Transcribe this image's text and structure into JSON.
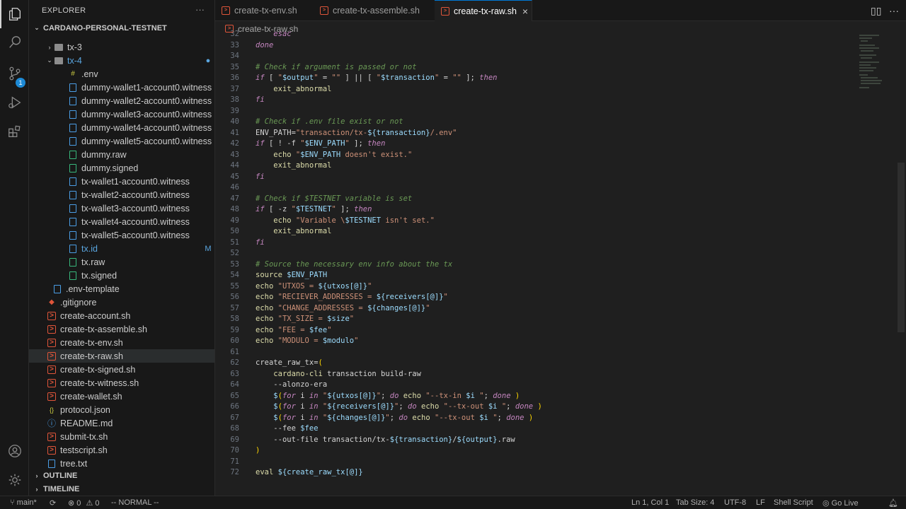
{
  "sidebar": {
    "title": "EXPLORER",
    "project": "CARDANO-PERSONAL-TESTNET",
    "outline": "OUTLINE",
    "timeline": "TIMELINE",
    "folders": {
      "tx3": "tx-3",
      "tx4": "tx-4"
    },
    "files": [
      {
        "name": ".env",
        "icon": "env-icon"
      },
      {
        "name": "dummy-wallet1-account0.witness",
        "icon": "file-icon"
      },
      {
        "name": "dummy-wallet2-account0.witness",
        "icon": "file-icon"
      },
      {
        "name": "dummy-wallet3-account0.witness",
        "icon": "file-icon"
      },
      {
        "name": "dummy-wallet4-account0.witness",
        "icon": "file-icon"
      },
      {
        "name": "dummy-wallet5-account0.witness",
        "icon": "file-icon"
      },
      {
        "name": "dummy.raw",
        "icon": "file-icon"
      },
      {
        "name": "dummy.signed",
        "icon": "file-icon"
      },
      {
        "name": "tx-wallet1-account0.witness",
        "icon": "file-icon"
      },
      {
        "name": "tx-wallet2-account0.witness",
        "icon": "file-icon"
      },
      {
        "name": "tx-wallet3-account0.witness",
        "icon": "file-icon"
      },
      {
        "name": "tx-wallet4-account0.witness",
        "icon": "file-icon"
      },
      {
        "name": "tx-wallet5-account0.witness",
        "icon": "file-icon"
      },
      {
        "name": "tx.id",
        "icon": "file-icon",
        "status": "M"
      },
      {
        "name": "tx.raw",
        "icon": "file-icon"
      },
      {
        "name": "tx.signed",
        "icon": "file-icon"
      },
      {
        "name": ".env-template",
        "icon": "file-icon"
      },
      {
        "name": ".gitignore",
        "icon": "git-icon"
      },
      {
        "name": "create-account.sh",
        "icon": "shell-icon"
      },
      {
        "name": "create-tx-assemble.sh",
        "icon": "shell-icon"
      },
      {
        "name": "create-tx-env.sh",
        "icon": "shell-icon"
      },
      {
        "name": "create-tx-raw.sh",
        "icon": "shell-icon"
      },
      {
        "name": "create-tx-signed.sh",
        "icon": "shell-icon"
      },
      {
        "name": "create-tx-witness.sh",
        "icon": "shell-icon"
      },
      {
        "name": "create-wallet.sh",
        "icon": "shell-icon"
      },
      {
        "name": "protocol.json",
        "icon": "json-icon"
      },
      {
        "name": "README.md",
        "icon": "info-icon"
      },
      {
        "name": "submit-tx.sh",
        "icon": "shell-icon"
      },
      {
        "name": "testscript.sh",
        "icon": "shell-icon"
      },
      {
        "name": "tree.txt",
        "icon": "file-icon"
      }
    ]
  },
  "tabs": [
    {
      "label": "create-tx-env.sh"
    },
    {
      "label": "create-tx-assemble.sh"
    },
    {
      "label": "create-tx-raw.sh"
    }
  ],
  "breadcrumb": "create-tx-raw.sh",
  "code_lines": [
    {
      "n": "32",
      "text": "    esac"
    },
    {
      "n": "33",
      "text": "done"
    },
    {
      "n": "34",
      "text": ""
    },
    {
      "n": "35",
      "text": "# Check if argument is passed or not"
    },
    {
      "n": "36",
      "text": "if [ \"$output\" = \"\" ] || [ \"$transaction\" = \"\" ]; then"
    },
    {
      "n": "37",
      "text": "    exit_abnormal"
    },
    {
      "n": "38",
      "text": "fi"
    },
    {
      "n": "39",
      "text": ""
    },
    {
      "n": "40",
      "text": "# Check if .env file exist or not"
    },
    {
      "n": "41",
      "text": "ENV_PATH=\"transaction/tx-${transaction}/.env\""
    },
    {
      "n": "42",
      "text": "if [ ! -f \"$ENV_PATH\" ]; then"
    },
    {
      "n": "43",
      "text": "    echo \"$ENV_PATH doesn't exist.\""
    },
    {
      "n": "44",
      "text": "    exit_abnormal"
    },
    {
      "n": "45",
      "text": "fi"
    },
    {
      "n": "46",
      "text": ""
    },
    {
      "n": "47",
      "text": "# Check if $TESTNET variable is set"
    },
    {
      "n": "48",
      "text": "if [ -z \"$TESTNET\" ]; then"
    },
    {
      "n": "49",
      "text": "    echo \"Variable \\$TESTNET isn't set.\""
    },
    {
      "n": "50",
      "text": "    exit_abnormal"
    },
    {
      "n": "51",
      "text": "fi"
    },
    {
      "n": "52",
      "text": ""
    },
    {
      "n": "53",
      "text": "# Source the necessary env info about the tx"
    },
    {
      "n": "54",
      "text": "source $ENV_PATH"
    },
    {
      "n": "55",
      "text": "echo \"UTXOS = ${utxos[@]}\""
    },
    {
      "n": "56",
      "text": "echo \"RECIEVER_ADDRESSES = ${receivers[@]}\""
    },
    {
      "n": "57",
      "text": "echo \"CHANGE_ADDRESSES = ${changes[@]}\""
    },
    {
      "n": "58",
      "text": "echo \"TX_SIZE = $size\""
    },
    {
      "n": "59",
      "text": "echo \"FEE = $fee\""
    },
    {
      "n": "60",
      "text": "echo \"MODULO = $modulo\""
    },
    {
      "n": "61",
      "text": ""
    },
    {
      "n": "62",
      "text": "create_raw_tx=("
    },
    {
      "n": "63",
      "text": "    cardano-cli transaction build-raw"
    },
    {
      "n": "64",
      "text": "    --alonzo-era"
    },
    {
      "n": "65",
      "text": "    $(for i in \"${utxos[@]}\"; do echo \"--tx-in $i \"; done )"
    },
    {
      "n": "66",
      "text": "    $(for i in \"${receivers[@]}\"; do echo \"--tx-out $i \"; done )"
    },
    {
      "n": "67",
      "text": "    $(for i in \"${changes[@]}\"; do echo \"--tx-out $i \"; done )"
    },
    {
      "n": "68",
      "text": "    --fee $fee"
    },
    {
      "n": "69",
      "text": "    --out-file transaction/tx-${transaction}/${output}.raw"
    },
    {
      "n": "70",
      "text": ")"
    },
    {
      "n": "71",
      "text": ""
    },
    {
      "n": "72",
      "text": "eval ${create_raw_tx[@]}"
    }
  ],
  "status": {
    "branch": "main*",
    "errors": "0",
    "warnings": "0",
    "mode": "-- NORMAL --",
    "position": "Ln 1, Col 1",
    "tab_size": "Tab Size: 4",
    "encoding": "UTF-8",
    "eol": "LF",
    "language": "Shell Script",
    "golive": "Go Live"
  },
  "badges": {
    "source_control": "1"
  },
  "colors": {
    "accent": "#0078d4",
    "shell": "#e0553a",
    "witness": "#4b9ee6",
    "modified": "#5aa6e0"
  }
}
